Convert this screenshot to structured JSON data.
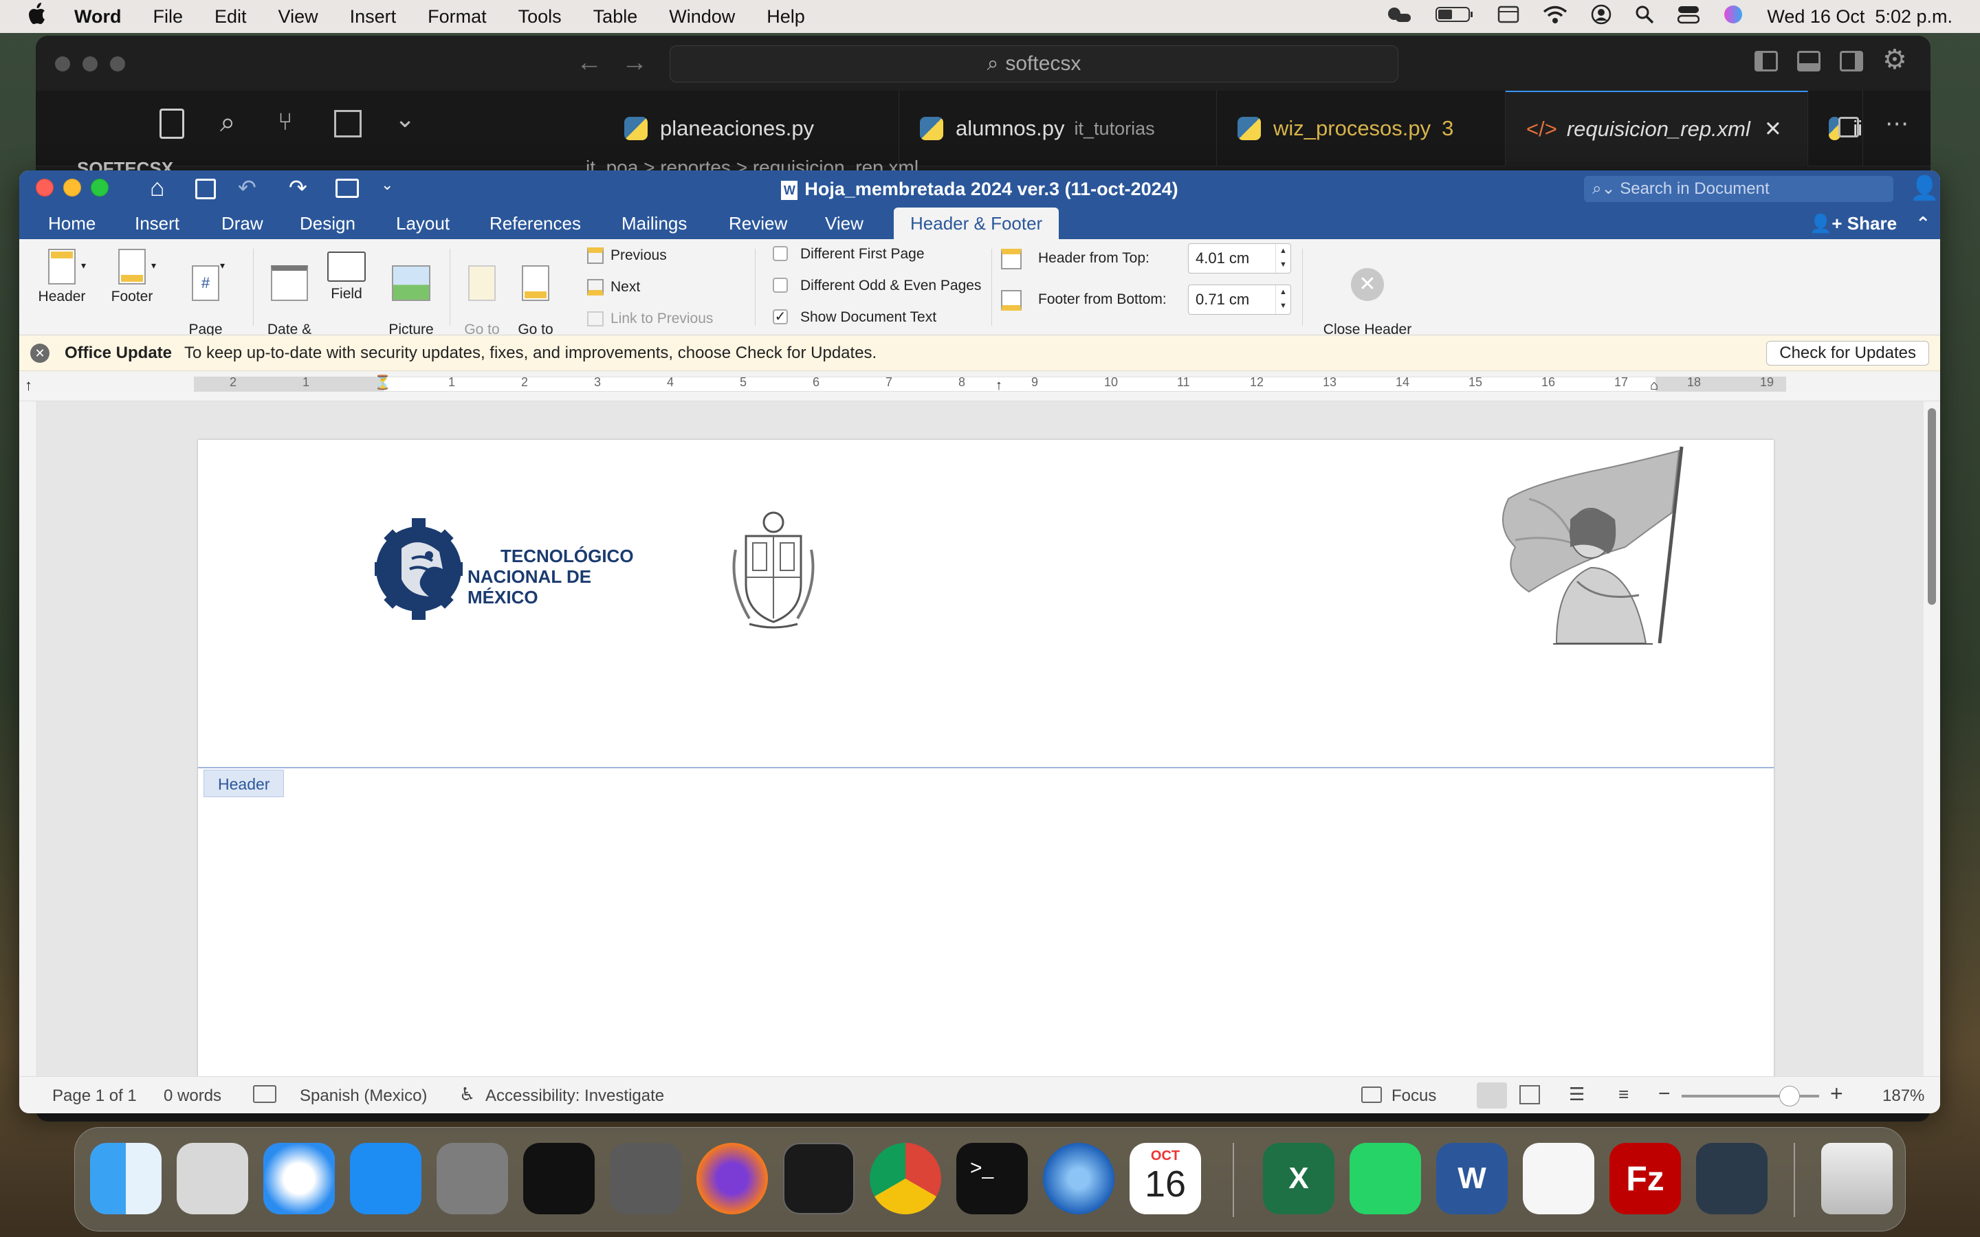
{
  "menubar": {
    "app": "Word",
    "items": [
      "File",
      "Edit",
      "View",
      "Insert",
      "Format",
      "Tools",
      "Table",
      "Window",
      "Help"
    ],
    "datetime": "Wed 16 Oct  5:02 p.m."
  },
  "vscode": {
    "search": "softecsx",
    "tabs": [
      {
        "name": "planeaciones.py",
        "sub": ""
      },
      {
        "name": "alumnos.py",
        "sub": "it_tutorias"
      },
      {
        "name": "wiz_procesos.py",
        "sub": "3"
      },
      {
        "name": "requisicion_rep.xml",
        "sub": ""
      },
      {
        "name": "ii",
        "sub": ""
      }
    ],
    "explorer_title": "SOFTECSX",
    "breadcrumb": "it_poa > reportes > requisicion_rep.xml"
  },
  "word": {
    "title": "Hoja_membretada 2024 ver.3 (11-oct-2024)",
    "search_placeholder": "Search in Document",
    "tabs": [
      "Home",
      "Insert",
      "Draw",
      "Design",
      "Layout",
      "References",
      "Mailings",
      "Review",
      "View",
      "Header & Footer"
    ],
    "share": "Share",
    "ribbon": {
      "header": "Header",
      "footer": "Footer",
      "page_number": "Page\nNumber",
      "date_time": "Date &\nTime",
      "field": "Field",
      "picture": "Picture\nfrom File",
      "goto_header": "Go to\nHeader",
      "goto_footer": "Go to\nFooter",
      "previous": "Previous",
      "next": "Next",
      "link_previous": "Link to Previous",
      "diff_first": "Different First Page",
      "diff_odd": "Different Odd & Even Pages",
      "show_doc": "Show Document Text",
      "header_from_top_label": "Header from Top:",
      "header_from_top": "4.01 cm",
      "footer_from_bottom_label": "Footer from Bottom:",
      "footer_from_bottom": "0.71 cm",
      "close": "Close Header\nand Footer"
    },
    "update": {
      "title": "Office Update",
      "message": "To keep up-to-date with security updates, fixes, and improvements, choose Check for Updates.",
      "button": "Check for Updates"
    },
    "ruler_numbers": [
      "2",
      "1",
      "",
      "1",
      "2",
      "3",
      "4",
      "5",
      "6",
      "7",
      "8",
      "9",
      "10",
      "11",
      "12",
      "13",
      "14",
      "15",
      "16",
      "17",
      "18",
      "19"
    ],
    "page": {
      "logo_line1": "TECNOLÓGICO",
      "logo_line2": "NACIONAL DE MÉXICO",
      "header_tag": "Header"
    },
    "status": {
      "page": "Page 1 of 1",
      "words": "0 words",
      "language": "Spanish (Mexico)",
      "accessibility": "Accessibility: Investigate",
      "focus": "Focus",
      "zoom": "187%"
    }
  },
  "dock": {
    "calendar_month": "OCT",
    "calendar_day": "16"
  },
  "colors": {
    "word_blue": "#2b579a",
    "tecnm_blue": "#1b3b6f"
  }
}
